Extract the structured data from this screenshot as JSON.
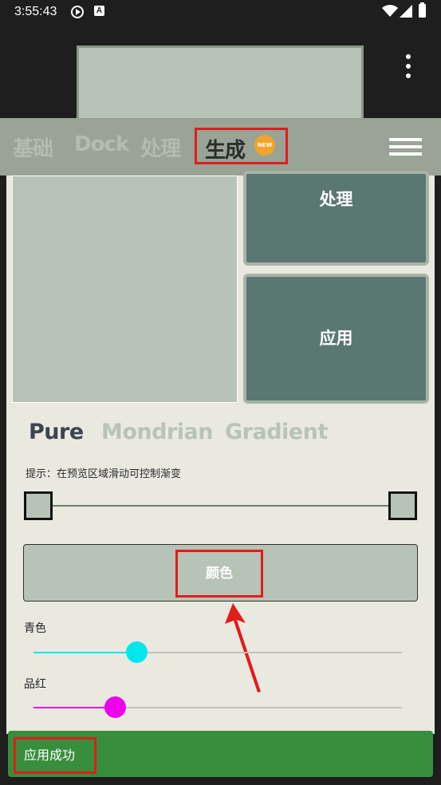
{
  "status_bar": {
    "time": "3:55:43",
    "a_badge": "A",
    "icons": [
      "play-circle-icon",
      "a-badge-icon",
      "wifi-icon",
      "signal-icon",
      "battery-icon"
    ]
  },
  "top_bar": {
    "more_icon": "more-vert-icon"
  },
  "tabs": {
    "basic": "基础",
    "dock": "Dock",
    "process": "处理",
    "generate": "生成",
    "new_badge": "NEW",
    "menu_icon": "hamburger-menu-icon"
  },
  "cards": {
    "process": "处理",
    "apply": "应用"
  },
  "modes": {
    "pure": "Pure",
    "mondrian": "Mondrian",
    "gradient": "Gradient",
    "selected": "Pure"
  },
  "hint": "提示：在预览区域滑动可控制渐变",
  "color_button": "颜色",
  "sliders": [
    {
      "label": "青色",
      "value": 0.28,
      "color": "#00e5ee"
    },
    {
      "label": "品红",
      "value": 0.22,
      "color": "#ee00ee"
    }
  ],
  "snackbar": {
    "text": "应用成功"
  },
  "colors": {
    "accent_dark": "#5a7772",
    "preview": "#b7c3b6",
    "tab_bar": "#99a396",
    "snackbar": "#388e3c",
    "highlight": "#e01c1c"
  }
}
